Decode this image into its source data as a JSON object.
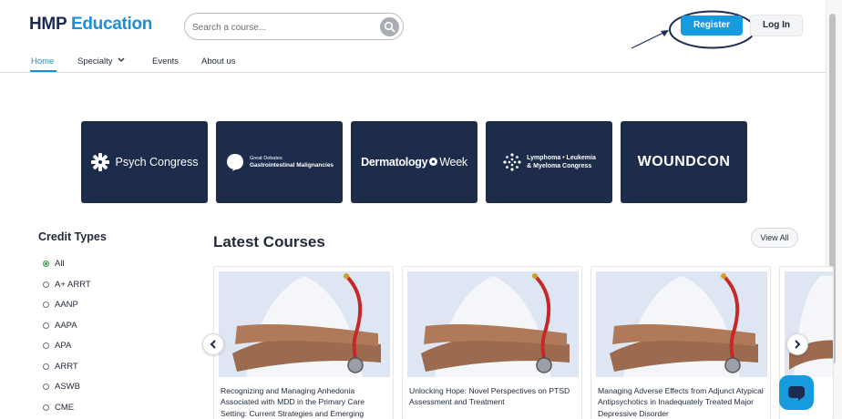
{
  "header": {
    "logo_hmp": "HMP",
    "logo_edu": "Education",
    "search_placeholder": "Search a course...",
    "register_label": "Register",
    "login_label": "Log In"
  },
  "nav": {
    "items": [
      {
        "label": "Home"
      },
      {
        "label": "Specialty"
      },
      {
        "label": "Events"
      },
      {
        "label": "About us"
      }
    ]
  },
  "banners": {
    "psych": "Psych Congress",
    "gd_top": "Great Debates",
    "gd_bottom": "Gastrointestinal Malignancies",
    "derm_bold": "Dermatology",
    "derm_light": "Week",
    "lym_1": "Lymphoma • Leukemia",
    "lym_2": "& Myeloma Congress",
    "wound": "WOUNDCON"
  },
  "credit_types": {
    "title": "Credit Types",
    "items": [
      "All",
      "A+ ARRT",
      "AANP",
      "AAPA",
      "APA",
      "ARRT",
      "ASWB",
      "CME"
    ],
    "selected": "All"
  },
  "courses": {
    "title": "Latest Courses",
    "view_all": "View All",
    "items": [
      {
        "title": "Recognizing and Managing Anhedonia Associated with MDD in the Primary Care Setting: Current Strategies and Emerging"
      },
      {
        "title": "Unlocking Hope: Novel Perspectives on PTSD Assessment and Treatment"
      },
      {
        "title": "Managing Adverse Effects from Adjunct Atypical Antipsychotics in Inadequately Treated Major Depressive Disorder"
      }
    ]
  },
  "icons": {
    "search": "search-icon",
    "prev": "chevron-left-icon",
    "next": "chevron-right-icon",
    "chat": "chat-icon"
  },
  "colors": {
    "brand_blue": "#159bde",
    "navy": "#1d2c4a",
    "active_radio": "#2f9e44"
  }
}
